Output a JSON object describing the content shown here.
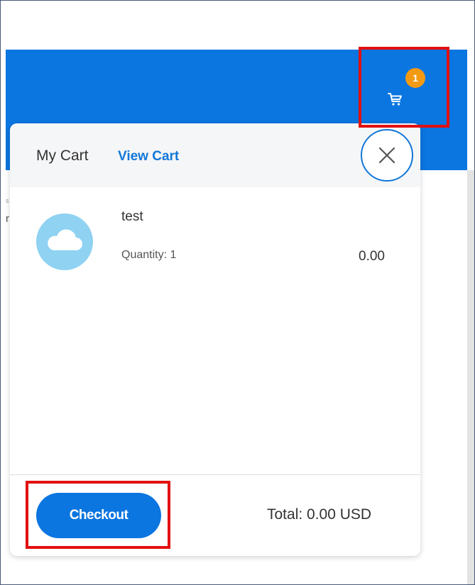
{
  "header": {
    "cart_count": "1"
  },
  "cart": {
    "title": "My Cart",
    "view_cart_label": "View Cart",
    "items": [
      {
        "name": "test",
        "quantity_label": "Quantity: 1",
        "price": "0.00"
      }
    ],
    "checkout_label": "Checkout",
    "total_label": "Total: 0.00 USD"
  },
  "background": {
    "partial_text": "r",
    "partial_text_small": "s"
  },
  "colors": {
    "brand_blue": "#0b75e0",
    "link_blue": "#1277d8",
    "badge_orange": "#f39a12",
    "highlight_red": "#e21010",
    "thumbnail_blue": "#8fd2f2"
  },
  "icons": {
    "cart": "cart-icon",
    "close": "close-icon",
    "item": "cloud-icon"
  }
}
